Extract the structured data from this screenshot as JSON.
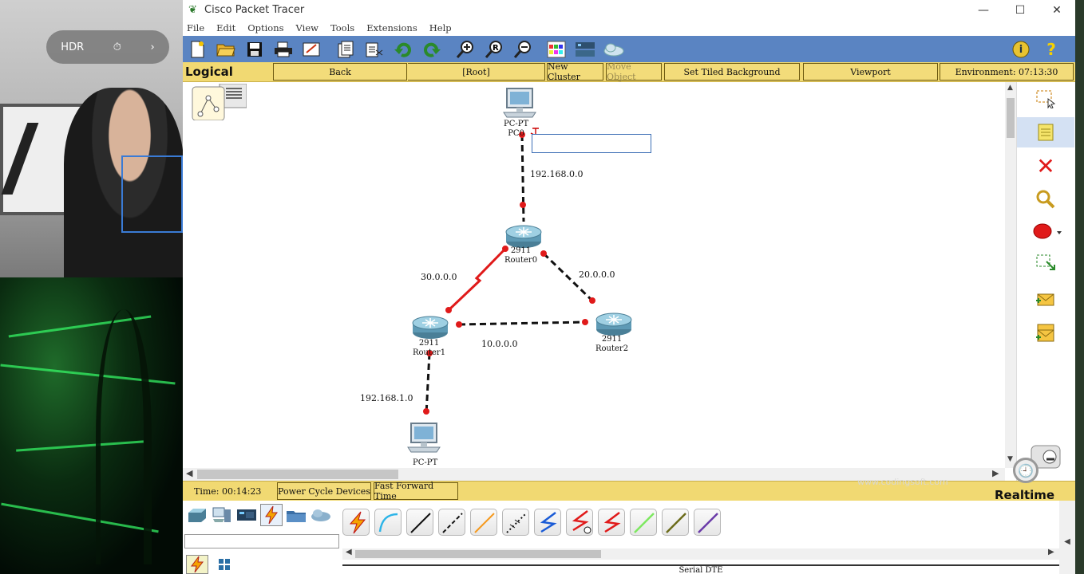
{
  "window": {
    "title": "Cisco Packet Tracer",
    "controls": {
      "minimize": "—",
      "maximize": "☐",
      "close": "✕"
    }
  },
  "overlay": {
    "webcam_controls": [
      "HDR",
      "⏱",
      "›"
    ]
  },
  "menu": [
    "File",
    "Edit",
    "Options",
    "View",
    "Tools",
    "Extensions",
    "Help"
  ],
  "toolbar": {
    "icons": [
      "new-file-icon",
      "open-folder-icon",
      "save-icon",
      "print-icon",
      "activity-wizard-icon",
      "copy-icon",
      "paste-icon",
      "undo-icon",
      "redo-icon",
      "zoom-in-icon",
      "zoom-reset-icon",
      "zoom-out-icon",
      "palette-icon",
      "device-template-icon",
      "cloud-icon"
    ],
    "right_icons": [
      "info-icon",
      "help-icon"
    ],
    "help_glyph": "?",
    "info_glyph": "i"
  },
  "navbar": {
    "logical": "Logical",
    "back": "Back",
    "root": "[Root]",
    "new_cluster": "New Cluster",
    "move_object": "Move Object",
    "set_tiled_background": "Set Tiled Background",
    "viewport": "Viewport",
    "environment": "Environment: 07:13:30"
  },
  "network": {
    "devices": [
      {
        "id": "pc0",
        "model": "PC-PT",
        "name": "PC0"
      },
      {
        "id": "router0",
        "model": "2911",
        "name": "Router0"
      },
      {
        "id": "router1",
        "model": "2911",
        "name": "Router1"
      },
      {
        "id": "router2",
        "model": "2911",
        "name": "Router2"
      },
      {
        "id": "pc1",
        "model": "PC-PT",
        "name": ""
      }
    ],
    "networks": [
      "192.168.0.0",
      "30.0.0.0",
      "20.0.0.0",
      "10.0.0.0",
      "192.168.1.0"
    ],
    "colors": {
      "serial_link": "#e01a1a",
      "ethernet_link": "#111111",
      "port_dot": "#e01a1a"
    }
  },
  "right_tools": [
    "select-icon",
    "note-icon",
    "delete-icon",
    "inspect-icon",
    "draw-ellipse-icon",
    "resize-icon",
    "add-simple-pdu-icon",
    "add-complex-pdu-icon"
  ],
  "statusbar": {
    "time": "Time: 00:14:23",
    "power_cycle": "Power Cycle Devices",
    "fast_forward": "Fast Forward Time",
    "mode": "Realtime",
    "watermark": "www.codingsoft.com"
  },
  "bottom": {
    "device_categories": [
      "network-devices-icon",
      "end-devices-icon",
      "components-icon",
      "connections-icon",
      "misc-icon",
      "multiuser-icon"
    ],
    "subcategories": [
      "connections-icon",
      "grid-icon"
    ],
    "cables": [
      "automatic-cable",
      "console-cable",
      "copper-straight-through",
      "copper-cross-over",
      "fiber-cable",
      "phone-cable",
      "coaxial-cable",
      "serial-dce-cable",
      "serial-dte-cable",
      "octal-cable",
      "iot-custom-cable",
      "usb-cable"
    ],
    "selected_cable_label": "Serial DTE"
  }
}
